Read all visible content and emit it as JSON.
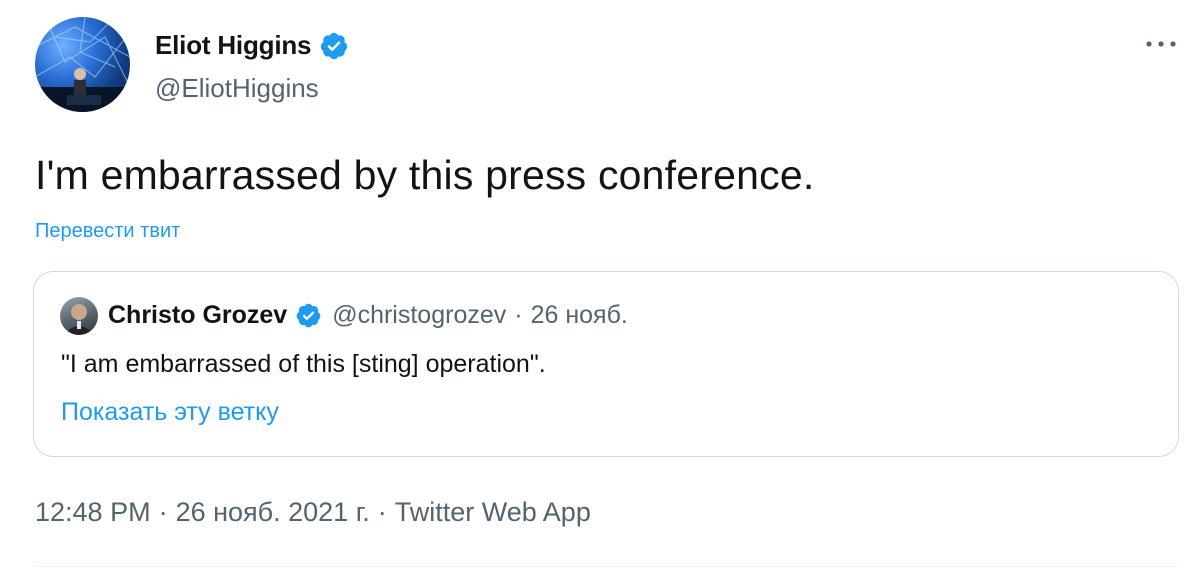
{
  "author": {
    "name": "Eliot Higgins",
    "handle": "@EliotHiggins",
    "verified_icon": "verified-badge-icon"
  },
  "tweet": {
    "text": "I'm embarrassed by this press conference.",
    "translate_label": "Перевести твит"
  },
  "quoted": {
    "name": "Christo Grozev",
    "handle": "@christogrozev",
    "separator": "·",
    "date": "26 нояб.",
    "text": "\"I am embarrassed of this [sting] operation\".",
    "show_thread_label": "Показать эту ветку"
  },
  "meta": {
    "time": "12:48 PM",
    "separator": "·",
    "date": "26 нояб. 2021 г.",
    "source": "Twitter Web App"
  },
  "colors": {
    "accent": "#1d9bf0",
    "secondary_text": "#536471",
    "primary_text": "#0f1419",
    "border": "#cfd9de"
  }
}
